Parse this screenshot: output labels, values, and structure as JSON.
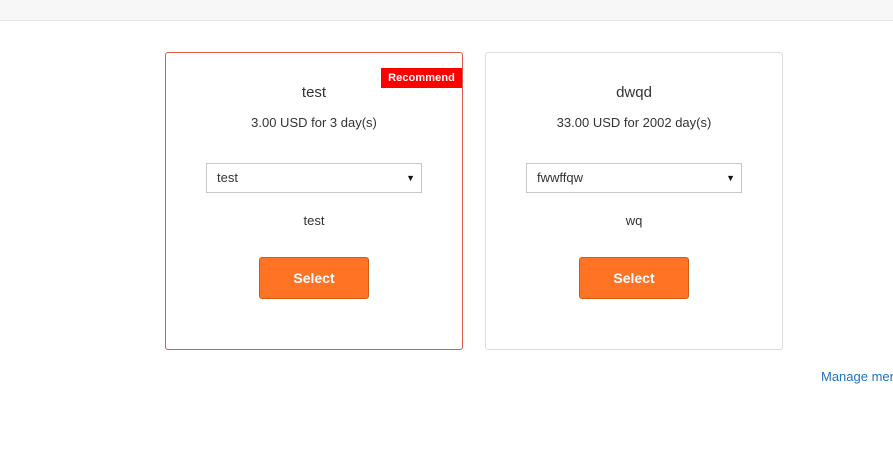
{
  "plans": [
    {
      "name": "test",
      "price": "3.00 USD for 3 day(s)",
      "badge": "Recommend",
      "select_value": "test",
      "description": "test",
      "button_label": "Select"
    },
    {
      "name": "dwqd",
      "price": "33.00 USD for 2002 day(s)",
      "select_value": "fwwffqw",
      "description": "wq",
      "button_label": "Select"
    }
  ],
  "footer": {
    "manage_link": "Manage mer"
  },
  "colors": {
    "accent": "#ff7324",
    "badge": "#ff0000",
    "recommended_border": "#e05a4a",
    "link": "#1e73be"
  },
  "icons": {
    "dropdown": "caret-down-icon"
  }
}
